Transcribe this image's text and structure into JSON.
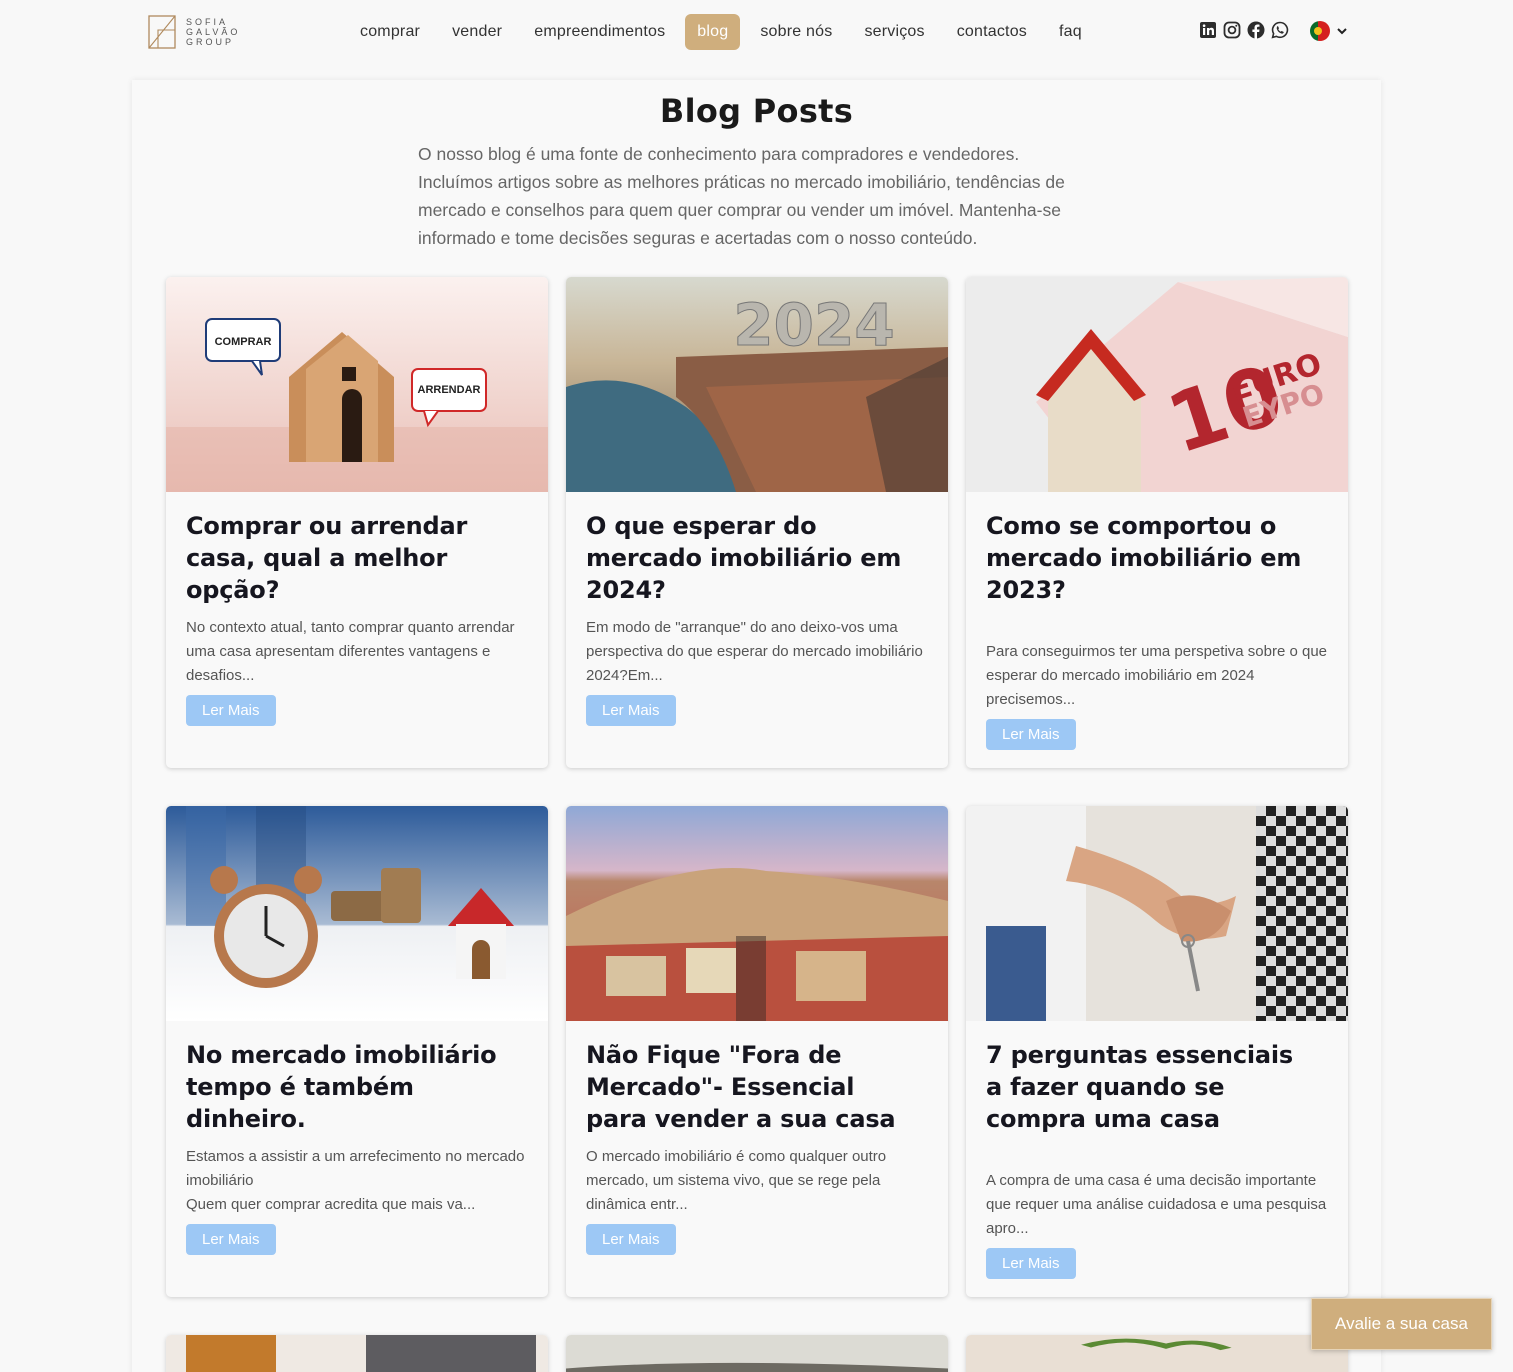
{
  "brand": {
    "logo_lines": [
      "SOFIA",
      "GALVÃO",
      "GROUP"
    ]
  },
  "nav": {
    "items": [
      {
        "label": "comprar"
      },
      {
        "label": "vender"
      },
      {
        "label": "empreendimentos"
      },
      {
        "label": "blog",
        "active": true
      },
      {
        "label": "sobre nós"
      },
      {
        "label": "serviços"
      },
      {
        "label": "contactos"
      },
      {
        "label": "faq"
      }
    ]
  },
  "social": [
    "linkedin-icon",
    "instagram-icon",
    "facebook-icon",
    "whatsapp-icon"
  ],
  "language": {
    "current": "pt",
    "icon": "portugal-flag-icon"
  },
  "page": {
    "title": "Blog Posts",
    "intro": "O nosso blog é uma fonte de conhecimento para compradores e vendedores. Incluímos artigos sobre as melhores práticas no mercado imobiliário, tendências de mercado e conselhos para quem quer comprar ou vender um imóvel. Mantenha-se informado e tome decisões seguras e acertadas com o nosso conteúdo."
  },
  "posts": [
    {
      "title": "Comprar ou arrendar casa, qual a melhor opção?",
      "excerpt": "No contexto atual, tanto comprar quanto arrendar uma casa apresentam diferentes vantagens e desafios...",
      "button": "Ler Mais",
      "image_bubbles": [
        "COMPRAR",
        "ARRENDAR"
      ]
    },
    {
      "title": "O que esperar do mercado imobiliário em 2024?",
      "excerpt": "Em modo de \"arranque\" do ano deixo-vos uma perspectiva do que esperar do mercado imobiliário 2024?Em...",
      "button": "Ler Mais",
      "image_text": "2024"
    },
    {
      "title": "Como se comportou o mercado imobiliário em 2023?",
      "excerpt": "Para conseguirmos ter uma perspetiva sobre o que esperar do mercado imobiliário em 2024 precisemos...",
      "button": "Ler Mais",
      "image_text": [
        "10",
        "EURO",
        "EYPO"
      ]
    },
    {
      "title": "No mercado imobiliário tempo é também dinheiro.",
      "excerpt": "Estamos a assistir a um arrefecimento no mercado imobiliário\nQuem quer comprar acredita que mais va...",
      "button": "Ler Mais"
    },
    {
      "title": "Não Fique \"Fora de Mercado\"- Essencial para vender a sua casa",
      "excerpt": "O mercado imobiliário é como qualquer outro mercado, um sistema vivo, que se rege pela dinâmica entr...",
      "button": "Ler Mais"
    },
    {
      "title": "7 perguntas essenciais a fazer quando se compra uma casa",
      "excerpt": "A compra de uma casa é uma decisão importante que requer uma análise cuidadosa e uma pesquisa apro...",
      "button": "Ler Mais"
    }
  ],
  "floating_button": {
    "label": "Avalie a sua casa"
  },
  "colors": {
    "accent": "#cfae7d",
    "button": "#9dc8f5"
  }
}
